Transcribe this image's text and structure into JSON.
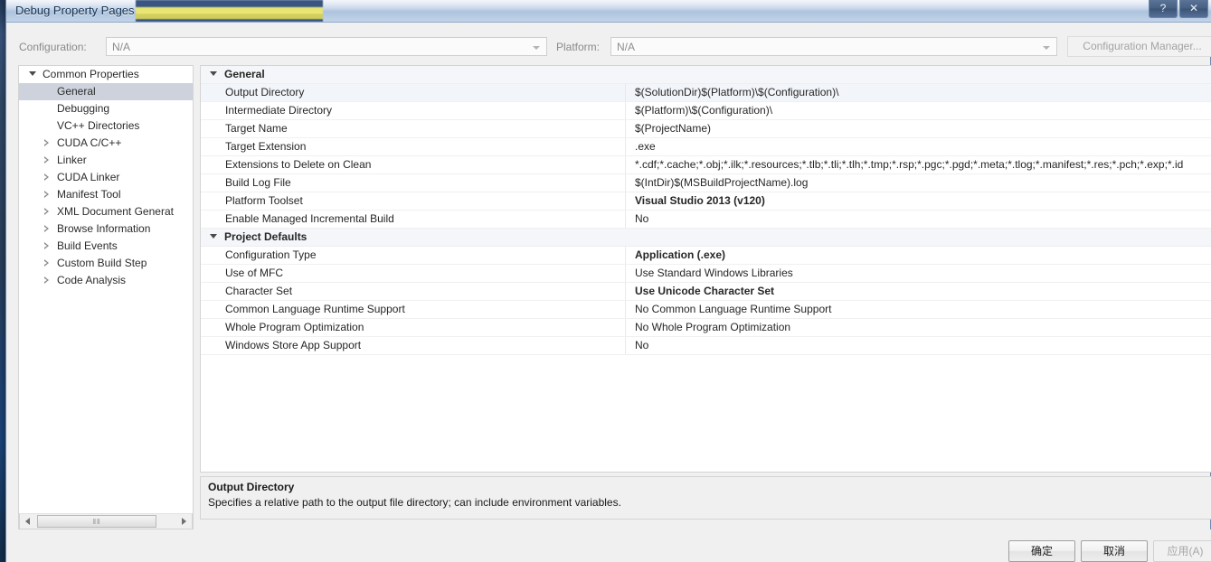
{
  "window": {
    "title": "Debug Property Pages",
    "redacted_title_note": "",
    "caption_buttons": [
      {
        "name": "help",
        "glyph": "?"
      },
      {
        "name": "close",
        "glyph": "✕"
      }
    ]
  },
  "config_bar": {
    "configuration_label": "Configuration:",
    "configuration_value": "N/A",
    "platform_label": "Platform:",
    "platform_value": "N/A",
    "configuration_manager_button": "Configuration Manager..."
  },
  "tree": {
    "items": [
      {
        "label": "Common Properties",
        "level": 0,
        "state": "expanded",
        "selected": false
      },
      {
        "label": "General",
        "level": 1,
        "state": "leaf",
        "selected": true
      },
      {
        "label": "Debugging",
        "level": 1,
        "state": "leaf",
        "selected": false
      },
      {
        "label": "VC++ Directories",
        "level": 1,
        "state": "leaf",
        "selected": false
      },
      {
        "label": "CUDA C/C++",
        "level": 1,
        "state": "collapsed",
        "selected": false
      },
      {
        "label": "Linker",
        "level": 1,
        "state": "collapsed",
        "selected": false
      },
      {
        "label": "CUDA Linker",
        "level": 1,
        "state": "collapsed",
        "selected": false
      },
      {
        "label": "Manifest Tool",
        "level": 1,
        "state": "collapsed",
        "selected": false
      },
      {
        "label": "XML Document Generat",
        "level": 1,
        "state": "collapsed",
        "selected": false
      },
      {
        "label": "Browse Information",
        "level": 1,
        "state": "collapsed",
        "selected": false
      },
      {
        "label": "Build Events",
        "level": 1,
        "state": "collapsed",
        "selected": false
      },
      {
        "label": "Custom Build Step",
        "level": 1,
        "state": "collapsed",
        "selected": false
      },
      {
        "label": "Code Analysis",
        "level": 1,
        "state": "collapsed",
        "selected": false
      }
    ],
    "scrollbar": {
      "left_arrow": "◂",
      "right_arrow": "▸",
      "grip": "‖‖"
    }
  },
  "grid": {
    "rows": [
      {
        "kind": "category",
        "name": "General",
        "value": ""
      },
      {
        "kind": "property",
        "name": "Output Directory",
        "value": "$(SolutionDir)$(Platform)\\$(Configuration)\\",
        "bold": false,
        "selected": true
      },
      {
        "kind": "property",
        "name": "Intermediate Directory",
        "value": "$(Platform)\\$(Configuration)\\",
        "bold": false,
        "selected": false
      },
      {
        "kind": "property",
        "name": "Target Name",
        "value": "$(ProjectName)",
        "bold": false,
        "selected": false
      },
      {
        "kind": "property",
        "name": "Target Extension",
        "value": ".exe",
        "bold": false,
        "selected": false
      },
      {
        "kind": "property",
        "name": "Extensions to Delete on Clean",
        "value": "*.cdf;*.cache;*.obj;*.ilk;*.resources;*.tlb;*.tli;*.tlh;*.tmp;*.rsp;*.pgc;*.pgd;*.meta;*.tlog;*.manifest;*.res;*.pch;*.exp;*.id",
        "bold": false,
        "selected": false
      },
      {
        "kind": "property",
        "name": "Build Log File",
        "value": "$(IntDir)$(MSBuildProjectName).log",
        "bold": false,
        "selected": false
      },
      {
        "kind": "property",
        "name": "Platform Toolset",
        "value": "Visual Studio 2013 (v120)",
        "bold": true,
        "selected": false
      },
      {
        "kind": "property",
        "name": "Enable Managed Incremental Build",
        "value": "No",
        "bold": false,
        "selected": false
      },
      {
        "kind": "category",
        "name": "Project Defaults",
        "value": ""
      },
      {
        "kind": "property",
        "name": "Configuration Type",
        "value": "Application (.exe)",
        "bold": true,
        "selected": false
      },
      {
        "kind": "property",
        "name": "Use of MFC",
        "value": "Use Standard Windows Libraries",
        "bold": false,
        "selected": false
      },
      {
        "kind": "property",
        "name": "Character Set",
        "value": "Use Unicode Character Set",
        "bold": true,
        "selected": false
      },
      {
        "kind": "property",
        "name": "Common Language Runtime Support",
        "value": "No Common Language Runtime Support",
        "bold": false,
        "selected": false
      },
      {
        "kind": "property",
        "name": "Whole Program Optimization",
        "value": "No Whole Program Optimization",
        "bold": false,
        "selected": false
      },
      {
        "kind": "property",
        "name": "Windows Store App Support",
        "value": "No",
        "bold": false,
        "selected": false
      }
    ]
  },
  "description": {
    "title": "Output Directory",
    "text": "Specifies a relative path to the output file directory; can include environment variables."
  },
  "footer": {
    "ok_label": "确定",
    "cancel_label": "取消",
    "apply_label": "应用(A)"
  },
  "colors": {
    "selection": "#cdd2dd",
    "category_bg": "#f4f6f9",
    "window_bg": "#f0f0f0",
    "desktop": "#1b3558"
  }
}
